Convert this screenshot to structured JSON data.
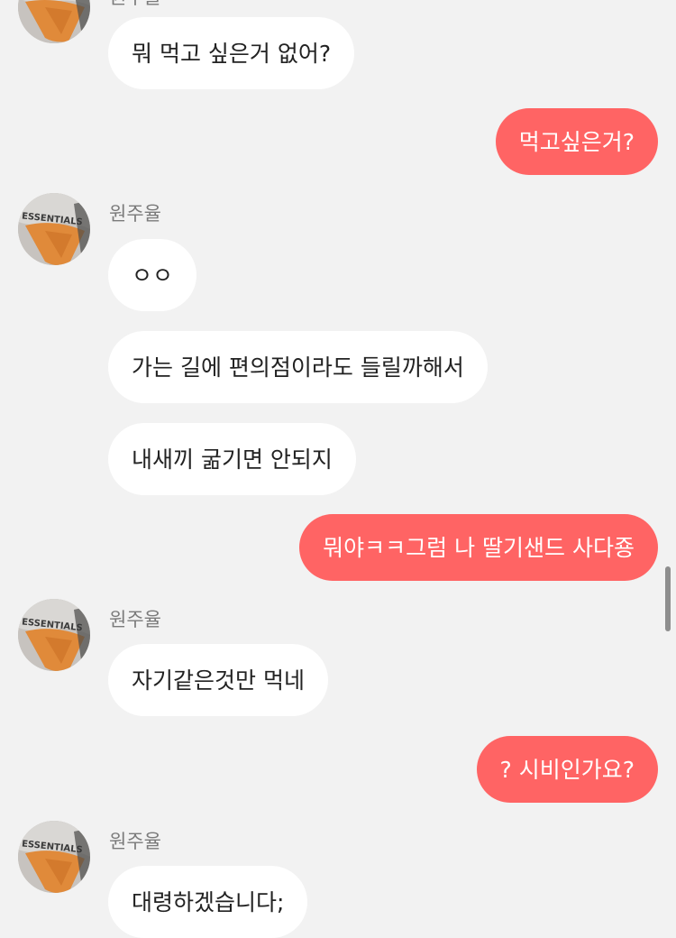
{
  "chat": {
    "accent_outgoing": "#ff6464",
    "incoming_bubble_color": "#ffffff",
    "background_color": "#f2f2f2",
    "avatar_print_text": "ESSENTIALS",
    "top_sender_partial": "원주율",
    "messages": [
      {
        "dir": "in",
        "text": "뭐 먹고 싶은거 없어?"
      },
      {
        "dir": "out",
        "text": "먹고싶은거?"
      },
      {
        "dir": "in",
        "sender": "원주율",
        "text": "ㅇㅇ"
      },
      {
        "dir": "in",
        "text": "가는 길에 편의점이라도 들릴까해서"
      },
      {
        "dir": "in",
        "text": "내새끼 굶기면 안되지"
      },
      {
        "dir": "out",
        "text": "뭐야ㅋㅋ그럼 나 딸기샌드 사다죵"
      },
      {
        "dir": "in",
        "sender": "원주율",
        "text": "자기같은것만 먹네"
      },
      {
        "dir": "out",
        "text": "? 시비인가요?"
      },
      {
        "dir": "in",
        "sender": "원주율",
        "text": "대령하겠습니다;"
      }
    ]
  }
}
